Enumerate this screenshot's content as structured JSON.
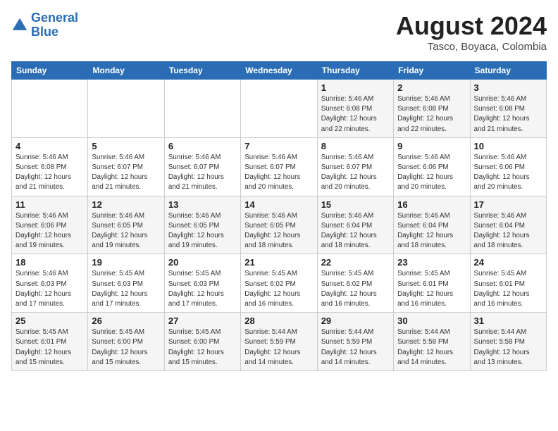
{
  "header": {
    "logo_line1": "General",
    "logo_line2": "Blue",
    "month": "August 2024",
    "location": "Tasco, Boyaca, Colombia"
  },
  "weekdays": [
    "Sunday",
    "Monday",
    "Tuesday",
    "Wednesday",
    "Thursday",
    "Friday",
    "Saturday"
  ],
  "weeks": [
    [
      {
        "day": "",
        "info": ""
      },
      {
        "day": "",
        "info": ""
      },
      {
        "day": "",
        "info": ""
      },
      {
        "day": "",
        "info": ""
      },
      {
        "day": "1",
        "info": "Sunrise: 5:46 AM\nSunset: 6:08 PM\nDaylight: 12 hours\nand 22 minutes."
      },
      {
        "day": "2",
        "info": "Sunrise: 5:46 AM\nSunset: 6:08 PM\nDaylight: 12 hours\nand 22 minutes."
      },
      {
        "day": "3",
        "info": "Sunrise: 5:46 AM\nSunset: 6:08 PM\nDaylight: 12 hours\nand 21 minutes."
      }
    ],
    [
      {
        "day": "4",
        "info": "Sunrise: 5:46 AM\nSunset: 6:08 PM\nDaylight: 12 hours\nand 21 minutes."
      },
      {
        "day": "5",
        "info": "Sunrise: 5:46 AM\nSunset: 6:07 PM\nDaylight: 12 hours\nand 21 minutes."
      },
      {
        "day": "6",
        "info": "Sunrise: 5:46 AM\nSunset: 6:07 PM\nDaylight: 12 hours\nand 21 minutes."
      },
      {
        "day": "7",
        "info": "Sunrise: 5:46 AM\nSunset: 6:07 PM\nDaylight: 12 hours\nand 20 minutes."
      },
      {
        "day": "8",
        "info": "Sunrise: 5:46 AM\nSunset: 6:07 PM\nDaylight: 12 hours\nand 20 minutes."
      },
      {
        "day": "9",
        "info": "Sunrise: 5:46 AM\nSunset: 6:06 PM\nDaylight: 12 hours\nand 20 minutes."
      },
      {
        "day": "10",
        "info": "Sunrise: 5:46 AM\nSunset: 6:06 PM\nDaylight: 12 hours\nand 20 minutes."
      }
    ],
    [
      {
        "day": "11",
        "info": "Sunrise: 5:46 AM\nSunset: 6:06 PM\nDaylight: 12 hours\nand 19 minutes."
      },
      {
        "day": "12",
        "info": "Sunrise: 5:46 AM\nSunset: 6:05 PM\nDaylight: 12 hours\nand 19 minutes."
      },
      {
        "day": "13",
        "info": "Sunrise: 5:46 AM\nSunset: 6:05 PM\nDaylight: 12 hours\nand 19 minutes."
      },
      {
        "day": "14",
        "info": "Sunrise: 5:46 AM\nSunset: 6:05 PM\nDaylight: 12 hours\nand 18 minutes."
      },
      {
        "day": "15",
        "info": "Sunrise: 5:46 AM\nSunset: 6:04 PM\nDaylight: 12 hours\nand 18 minutes."
      },
      {
        "day": "16",
        "info": "Sunrise: 5:46 AM\nSunset: 6:04 PM\nDaylight: 12 hours\nand 18 minutes."
      },
      {
        "day": "17",
        "info": "Sunrise: 5:46 AM\nSunset: 6:04 PM\nDaylight: 12 hours\nand 18 minutes."
      }
    ],
    [
      {
        "day": "18",
        "info": "Sunrise: 5:46 AM\nSunset: 6:03 PM\nDaylight: 12 hours\nand 17 minutes."
      },
      {
        "day": "19",
        "info": "Sunrise: 5:45 AM\nSunset: 6:03 PM\nDaylight: 12 hours\nand 17 minutes."
      },
      {
        "day": "20",
        "info": "Sunrise: 5:45 AM\nSunset: 6:03 PM\nDaylight: 12 hours\nand 17 minutes."
      },
      {
        "day": "21",
        "info": "Sunrise: 5:45 AM\nSunset: 6:02 PM\nDaylight: 12 hours\nand 16 minutes."
      },
      {
        "day": "22",
        "info": "Sunrise: 5:45 AM\nSunset: 6:02 PM\nDaylight: 12 hours\nand 16 minutes."
      },
      {
        "day": "23",
        "info": "Sunrise: 5:45 AM\nSunset: 6:01 PM\nDaylight: 12 hours\nand 16 minutes."
      },
      {
        "day": "24",
        "info": "Sunrise: 5:45 AM\nSunset: 6:01 PM\nDaylight: 12 hours\nand 16 minutes."
      }
    ],
    [
      {
        "day": "25",
        "info": "Sunrise: 5:45 AM\nSunset: 6:01 PM\nDaylight: 12 hours\nand 15 minutes."
      },
      {
        "day": "26",
        "info": "Sunrise: 5:45 AM\nSunset: 6:00 PM\nDaylight: 12 hours\nand 15 minutes."
      },
      {
        "day": "27",
        "info": "Sunrise: 5:45 AM\nSunset: 6:00 PM\nDaylight: 12 hours\nand 15 minutes."
      },
      {
        "day": "28",
        "info": "Sunrise: 5:44 AM\nSunset: 5:59 PM\nDaylight: 12 hours\nand 14 minutes."
      },
      {
        "day": "29",
        "info": "Sunrise: 5:44 AM\nSunset: 5:59 PM\nDaylight: 12 hours\nand 14 minutes."
      },
      {
        "day": "30",
        "info": "Sunrise: 5:44 AM\nSunset: 5:58 PM\nDaylight: 12 hours\nand 14 minutes."
      },
      {
        "day": "31",
        "info": "Sunrise: 5:44 AM\nSunset: 5:58 PM\nDaylight: 12 hours\nand 13 minutes."
      }
    ]
  ]
}
